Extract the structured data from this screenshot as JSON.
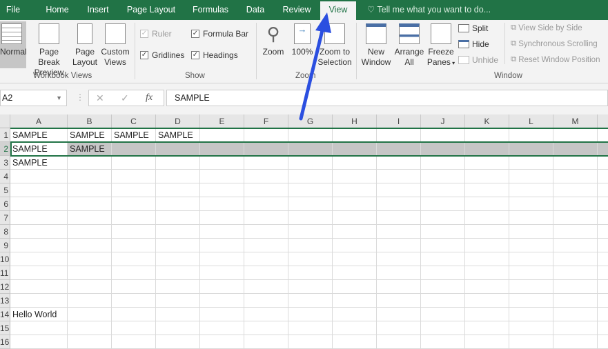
{
  "tabs": [
    "File",
    "Home",
    "Insert",
    "Page Layout",
    "Formulas",
    "Data",
    "Review",
    "View"
  ],
  "active_tab": "View",
  "tell_me": "Tell me what you want to do...",
  "workbook_views": {
    "group": "Workbook Views",
    "normal": "Normal",
    "page_break_1": "Page Break",
    "page_break_2": "Preview",
    "page_layout_1": "Page",
    "page_layout_2": "Layout",
    "custom_1": "Custom",
    "custom_2": "Views"
  },
  "show": {
    "group": "Show",
    "ruler": "Ruler",
    "formula_bar": "Formula Bar",
    "gridlines": "Gridlines",
    "headings": "Headings"
  },
  "zoom": {
    "group": "Zoom",
    "zoom": "Zoom",
    "hundred": "100%",
    "zoom_sel_1": "Zoom to",
    "zoom_sel_2": "Selection"
  },
  "window": {
    "group": "Window",
    "new_1": "New",
    "new_2": "Window",
    "arrange_1": "Arrange",
    "arrange_2": "All",
    "freeze_1": "Freeze",
    "freeze_2": "Panes",
    "split": "Split",
    "hide": "Hide",
    "unhide": "Unhide",
    "side": "View Side by Side",
    "sync": "Synchronous Scrolling",
    "reset": "Reset Window Position"
  },
  "name_box": "A2",
  "formula_value": "SAMPLE",
  "columns": [
    "A",
    "B",
    "C",
    "D",
    "E",
    "F",
    "G",
    "H",
    "I",
    "J",
    "K",
    "L",
    "M"
  ],
  "rows": [
    "1",
    "2",
    "3",
    "4",
    "5",
    "6",
    "7",
    "8",
    "9",
    "10",
    "11",
    "12",
    "13",
    "14",
    "15",
    "16"
  ],
  "cells": {
    "A1": "SAMPLE",
    "B1": "SAMPLE",
    "C1": "SAMPLE",
    "D1": "SAMPLE",
    "A2": "SAMPLE",
    "B2": "SAMPLE",
    "A3": "SAMPLE",
    "A14": "Hello World"
  },
  "colors": {
    "accent": "#217346",
    "arrow": "#2b4fe0"
  }
}
